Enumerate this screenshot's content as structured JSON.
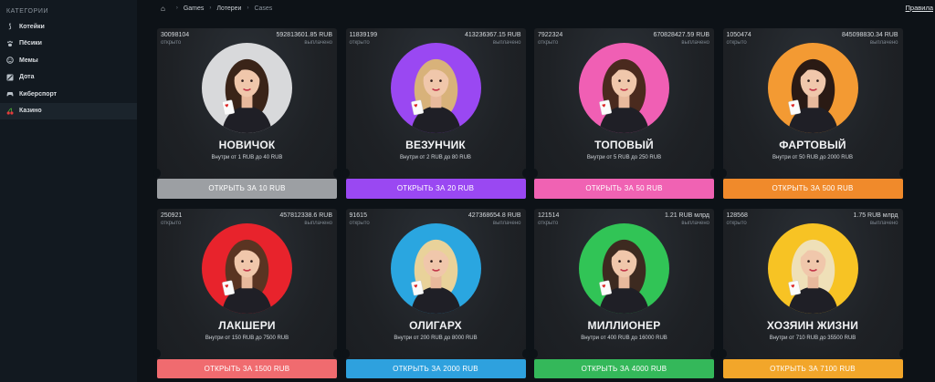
{
  "sidebar": {
    "title": "КАТЕГОРИИ",
    "items": [
      {
        "label": "Котейки",
        "icon": "tail-icon"
      },
      {
        "label": "Пёсики",
        "icon": "paw-icon"
      },
      {
        "label": "Мемы",
        "icon": "face-icon"
      },
      {
        "label": "Дота",
        "icon": "dota-icon"
      },
      {
        "label": "Киберспорт",
        "icon": "gamepad-icon"
      },
      {
        "label": "Казино",
        "icon": "cherry-icon",
        "active": true
      }
    ]
  },
  "topbar": {
    "breadcrumb": [
      "Games",
      "Лотереи",
      "Cases"
    ],
    "rules_link": "Правила"
  },
  "cases": [
    {
      "opened": "30098104",
      "opened_label": "открыто",
      "paid": "592813601.85 RUB",
      "paid_label": "выплачено",
      "name": "НОВИЧОК",
      "range": "Внутри от 1 RUB до 40 RUB",
      "button": "ОТКРЫТЬ ЗА 10 RUB",
      "button_color": "#9c9fa3",
      "bg_color": "#d8d9db"
    },
    {
      "opened": "11839199",
      "opened_label": "открыто",
      "paid": "413236367.15 RUB",
      "paid_label": "выплачено",
      "name": "ВЕЗУНЧИК",
      "range": "Внутри от 2 RUB до 80 RUB",
      "button": "ОТКРЫТЬ ЗА 20 RUB",
      "button_color": "#9a48f2",
      "bg_color": "#9a48f2"
    },
    {
      "opened": "7922324",
      "opened_label": "открыто",
      "paid": "670828427.59 RUB",
      "paid_label": "выплачено",
      "name": "ТОПОВЫЙ",
      "range": "Внутри от 5 RUB до 250 RUB",
      "button": "ОТКРЫТЬ ЗА 50 RUB",
      "button_color": "#f062b3",
      "bg_color": "#f05fb4"
    },
    {
      "opened": "1050474",
      "opened_label": "открыто",
      "paid": "845098830.34 RUB",
      "paid_label": "выплачено",
      "name": "ФАРТОВЫЙ",
      "range": "Внутри от 50 RUB до 2000 RUB",
      "button": "ОТКРЫТЬ ЗА 500 RUB",
      "button_color": "#f08a2b",
      "bg_color": "#f39a33"
    },
    {
      "opened": "250921",
      "opened_label": "открыто",
      "paid": "457812338.6 RUB",
      "paid_label": "выплачено",
      "name": "ЛАКШЕРИ",
      "range": "Внутри от 150 RUB до 7500 RUB",
      "button": "ОТКРЫТЬ ЗА 1500 RUB",
      "button_color": "#f06b6f",
      "bg_color": "#e8232c"
    },
    {
      "opened": "91615",
      "opened_label": "открыто",
      "paid": "427368654.8 RUB",
      "paid_label": "выплачено",
      "name": "ОЛИГАРХ",
      "range": "Внутри от 200 RUB до 8000 RUB",
      "button": "ОТКРЫТЬ ЗА 2000 RUB",
      "button_color": "#2ea1de",
      "bg_color": "#2aa6e0"
    },
    {
      "opened": "121514",
      "opened_label": "открыто",
      "paid": "1.21 RUB млрд",
      "paid_label": "выплачено",
      "name": "МИЛЛИОНЕР",
      "range": "Внутри от 400 RUB до 16000 RUB",
      "button": "ОТКРЫТЬ ЗА 4000 RUB",
      "button_color": "#34b85a",
      "bg_color": "#31c456"
    },
    {
      "opened": "128568",
      "opened_label": "открыто",
      "paid": "1.75 RUB млрд",
      "paid_label": "выплачено",
      "name": "ХОЗЯИН ЖИЗНИ",
      "range": "Внутри от 710 RUB до 35500 RUB",
      "button": "ОТКРЫТЬ ЗА 7100 RUB",
      "button_color": "#f2a62a",
      "bg_color": "#f7c324"
    }
  ]
}
